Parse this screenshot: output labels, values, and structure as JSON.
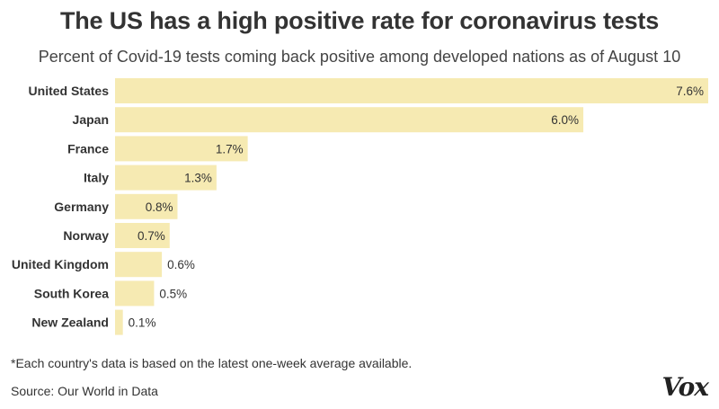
{
  "title": "The US has a high positive rate for coronavirus tests",
  "subtitle": "Percent of Covid-19 tests coming back positive among developed nations as of August 10",
  "footnote": "*Each country's data is based on the latest one-week average available.",
  "source": "Source: Our World in Data",
  "logo_text": "Vox",
  "colors": {
    "bar": "#f6eab2",
    "text": "#333333"
  },
  "chart_data": {
    "type": "bar",
    "orientation": "horizontal",
    "categories": [
      "United States",
      "Japan",
      "France",
      "Italy",
      "Germany",
      "Norway",
      "United Kingdom",
      "South Korea",
      "New Zealand"
    ],
    "values": [
      7.6,
      6.0,
      1.7,
      1.3,
      0.8,
      0.7,
      0.6,
      0.5,
      0.1
    ],
    "value_labels": [
      "7.6%",
      "6.0%",
      "1.7%",
      "1.3%",
      "0.8%",
      "0.7%",
      "0.6%",
      "0.5%",
      "0.1%"
    ],
    "title": "The US has a high positive rate for coronavirus tests",
    "xlim": [
      0,
      7.6
    ],
    "grid": false,
    "legend": false
  }
}
